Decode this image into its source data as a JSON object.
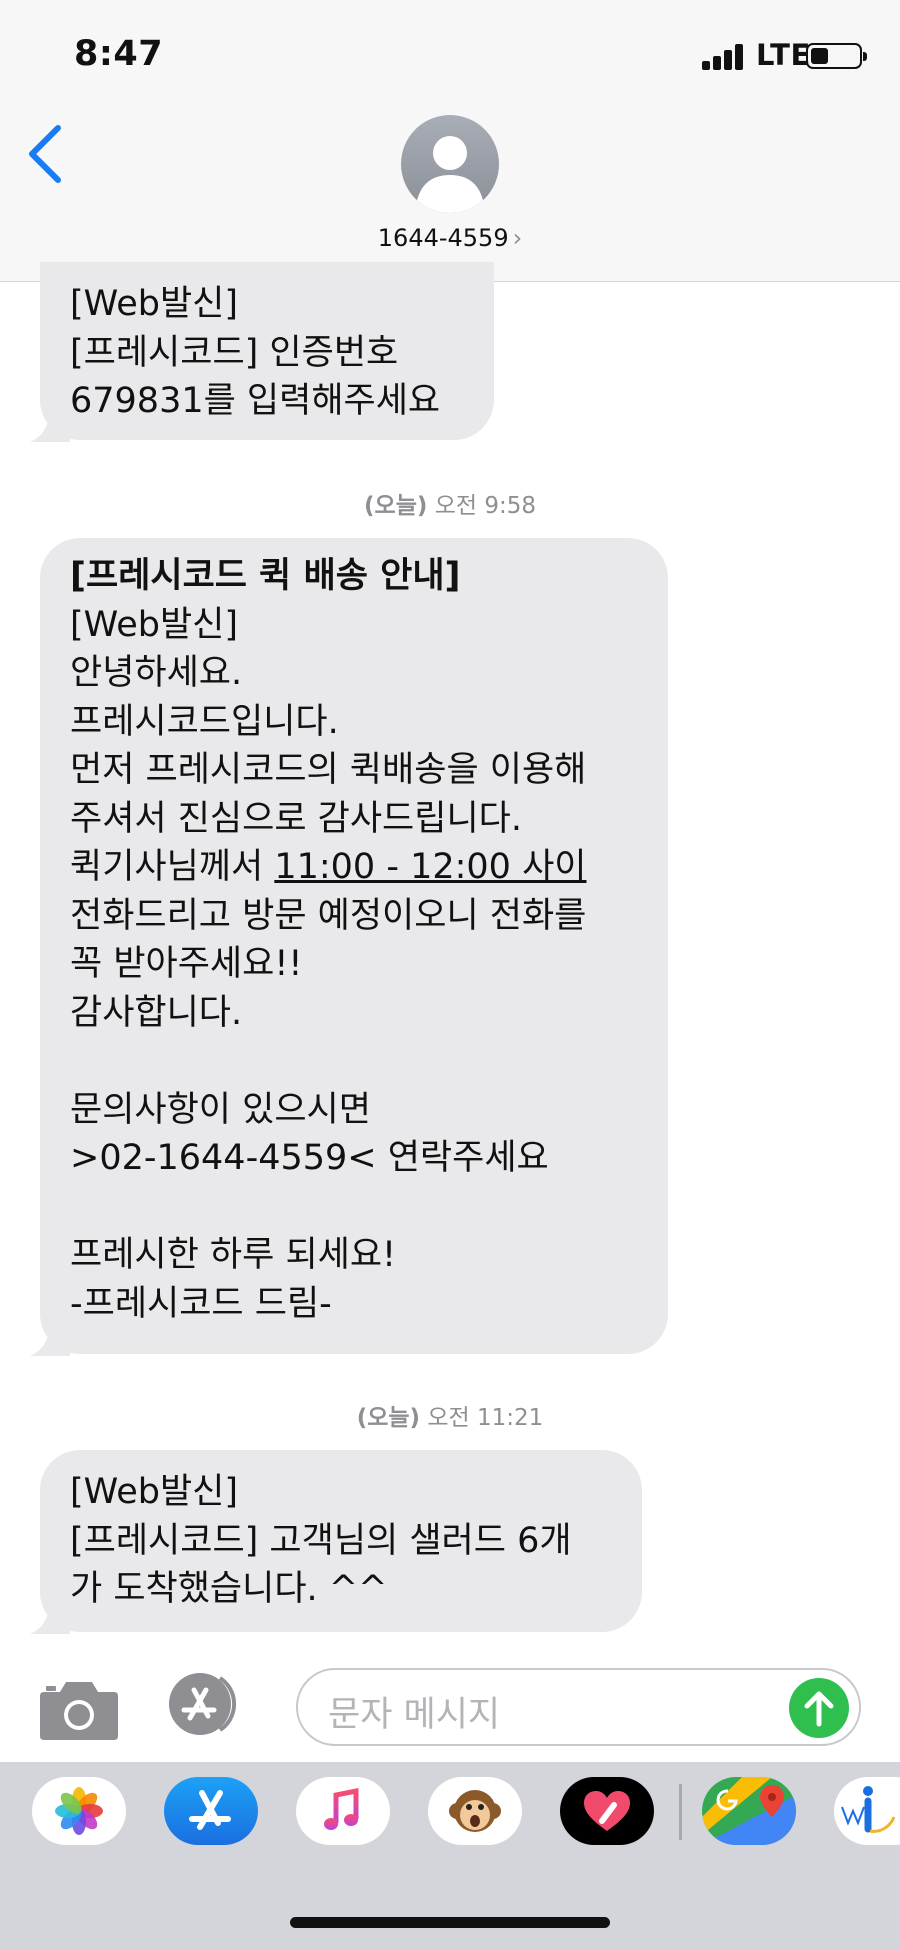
{
  "status_bar": {
    "time": "8:47",
    "network": "LTE"
  },
  "header": {
    "contact": "1644-4559",
    "contact_chevron": "›"
  },
  "messages": [
    {
      "lines": [
        "[Web발신]",
        "[프레시코드] 인증번호",
        "679831를 입력해주세요"
      ]
    },
    {
      "lines": [
        "[프레시코드 퀵 배송 안내]",
        "[Web발신]",
        "안녕하세요.",
        "프레시코드입니다.",
        "먼저 프레시코드의 퀵배송을 이용해",
        "주셔서 진심으로 감사드립니다.",
        "퀵기사님께서 ",
        "11:00 - 12:00 사이",
        "전화드리고 방문 예정이오니 전화를",
        "꼭 받아주세요!!",
        "감사합니다.",
        "",
        "문의사항이 있으시면",
        ">02-1644-4559< 연락주세요",
        "",
        "프레시한 하루 되세요!",
        "-프레시코드 드림-"
      ]
    },
    {
      "lines": [
        "[Web발신]",
        "[프레시코드] 고객님의 샐러드 6개",
        "가 도착했습니다. ^^"
      ]
    }
  ],
  "timestamps": [
    {
      "day": "(오늘)",
      "time": "오전 9:58"
    },
    {
      "day": "(오늘)",
      "time": "오전 11:21"
    }
  ],
  "composer": {
    "placeholder": "문자 메시지"
  },
  "icons": {
    "back": "chevron-left-icon",
    "camera": "camera-icon",
    "appstore": "app-store-icon",
    "send": "arrow-up-icon",
    "dock": [
      "photos-icon",
      "app-store-icon",
      "music-icon",
      "animoji-monkey-icon",
      "heart-digital-touch-icon",
      "google-maps-icon",
      "info-app-icon"
    ]
  },
  "colors": {
    "bubble": "#e9e9eb",
    "ios_blue": "#1a7cf5",
    "send_green": "#2fbf4e"
  }
}
